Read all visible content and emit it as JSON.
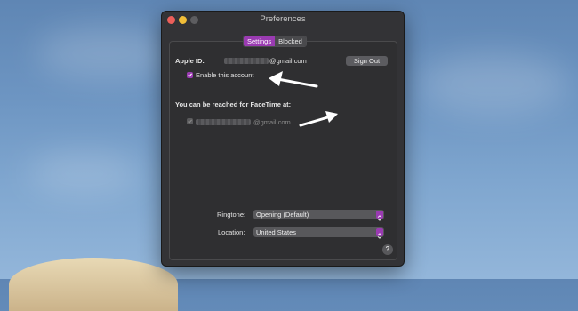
{
  "window": {
    "title": "Preferences"
  },
  "tabs": [
    {
      "label": "Settings",
      "active": true
    },
    {
      "label": "Blocked",
      "active": false
    }
  ],
  "account": {
    "apple_id_label": "Apple ID:",
    "apple_id_suffix": "@gmail.com",
    "sign_out_label": "Sign Out",
    "enable_label": "Enable this account",
    "enable_checked": true
  },
  "facetime": {
    "reach_label": "You can be reached for FaceTime at:",
    "address_suffix": "@gmail.com",
    "address_checked": true
  },
  "ringtone": {
    "label": "Ringtone:",
    "value": "Opening (Default)"
  },
  "location": {
    "label": "Location:",
    "value": "United States"
  },
  "help": {
    "label": "?"
  },
  "colors": {
    "accent": "#9a3bb2",
    "window_bg": "#333336",
    "annotation_arrow": "#ffffff"
  },
  "icons": [
    "close-icon",
    "minimize-icon",
    "zoom-icon",
    "checkmark-icon",
    "chevron-updown-icon",
    "question-icon",
    "annotation-arrow-icon"
  ]
}
